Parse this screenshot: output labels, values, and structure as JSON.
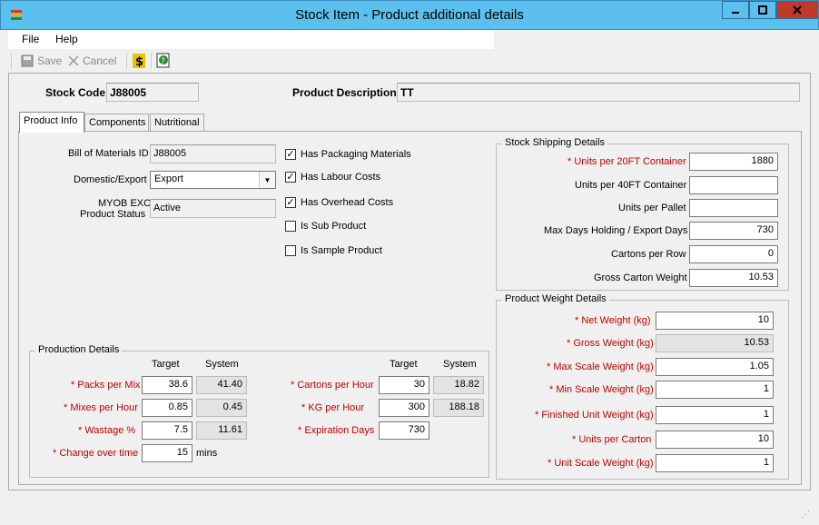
{
  "window": {
    "title": "Stock Item - Product additional details",
    "min_icon": "minimize-icon",
    "max_icon": "maximize-icon",
    "close_icon": "close-icon"
  },
  "menu": {
    "file": "File",
    "help": "Help"
  },
  "toolbar": {
    "save": "Save",
    "cancel": "Cancel"
  },
  "header": {
    "stock_code_label": "Stock Code",
    "stock_code": "J88005",
    "desc_label": "Product Description",
    "desc": "TT"
  },
  "tabs": [
    "Product Info",
    "Components",
    "Nutritional"
  ],
  "info": {
    "bom_label": "Bill of Materials ID",
    "bom": "J88005",
    "domexp_label": "Domestic/Export",
    "domexp": "Export",
    "myob_label1": "MYOB EXO",
    "myob_label2": "Product Status",
    "myob": "Active",
    "checks": [
      {
        "label": "Has Packaging Materials",
        "checked": true
      },
      {
        "label": "Has Labour Costs",
        "checked": true
      },
      {
        "label": "Has Overhead Costs",
        "checked": true
      },
      {
        "label": "Is Sub Product",
        "checked": false
      },
      {
        "label": "Is Sample Product",
        "checked": false
      }
    ]
  },
  "production": {
    "title": "Production Details",
    "target": "Target",
    "system": "System",
    "packs_label": "* Packs per Mix",
    "packs_t": "38.6",
    "packs_s": "41.40",
    "mixes_label": "* Mixes per Hour",
    "mixes_t": "0.85",
    "mixes_s": "0.45",
    "wastage_label": "* Wastage %",
    "wastage_t": "7.5",
    "wastage_s": "11.61",
    "change_label": "* Change over time",
    "change_t": "15",
    "change_unit": "mins",
    "cartons_label": "* Cartons per Hour",
    "cartons_t": "30",
    "cartons_s": "18.82",
    "kg_label": "* KG per Hour",
    "kg_t": "300",
    "kg_s": "188.18",
    "exp_label": "* Expiration Days",
    "exp_t": "730"
  },
  "shipping": {
    "title": "Stock Shipping Details",
    "rows": [
      {
        "label": "* Units per 20FT Container",
        "value": "1880",
        "req": true
      },
      {
        "label": "Units per 40FT Container",
        "value": "",
        "req": false
      },
      {
        "label": "Units per Pallet",
        "value": "",
        "req": false
      },
      {
        "label": "Max Days Holding / Export Days",
        "value": "730",
        "req": false
      },
      {
        "label": "Cartons per Row",
        "value": "0",
        "req": false
      },
      {
        "label": "Gross Carton Weight",
        "value": "10.53",
        "req": false
      }
    ]
  },
  "weight": {
    "title": "Product Weight Details",
    "rows": [
      {
        "label": "* Net Weight (kg)",
        "value": "10"
      },
      {
        "label": "* Gross Weight (kg)",
        "value": "10.53"
      },
      {
        "label": "* Max Scale Weight (kg)",
        "value": "1.05"
      },
      {
        "label": "* Min Scale Weight (kg)",
        "value": "1"
      },
      {
        "label": "* Finished Unit Weight (kg)",
        "value": "1"
      },
      {
        "label": "* Units per Carton",
        "value": "10"
      },
      {
        "label": "* Unit Scale Weight (kg)",
        "value": "1"
      }
    ]
  }
}
